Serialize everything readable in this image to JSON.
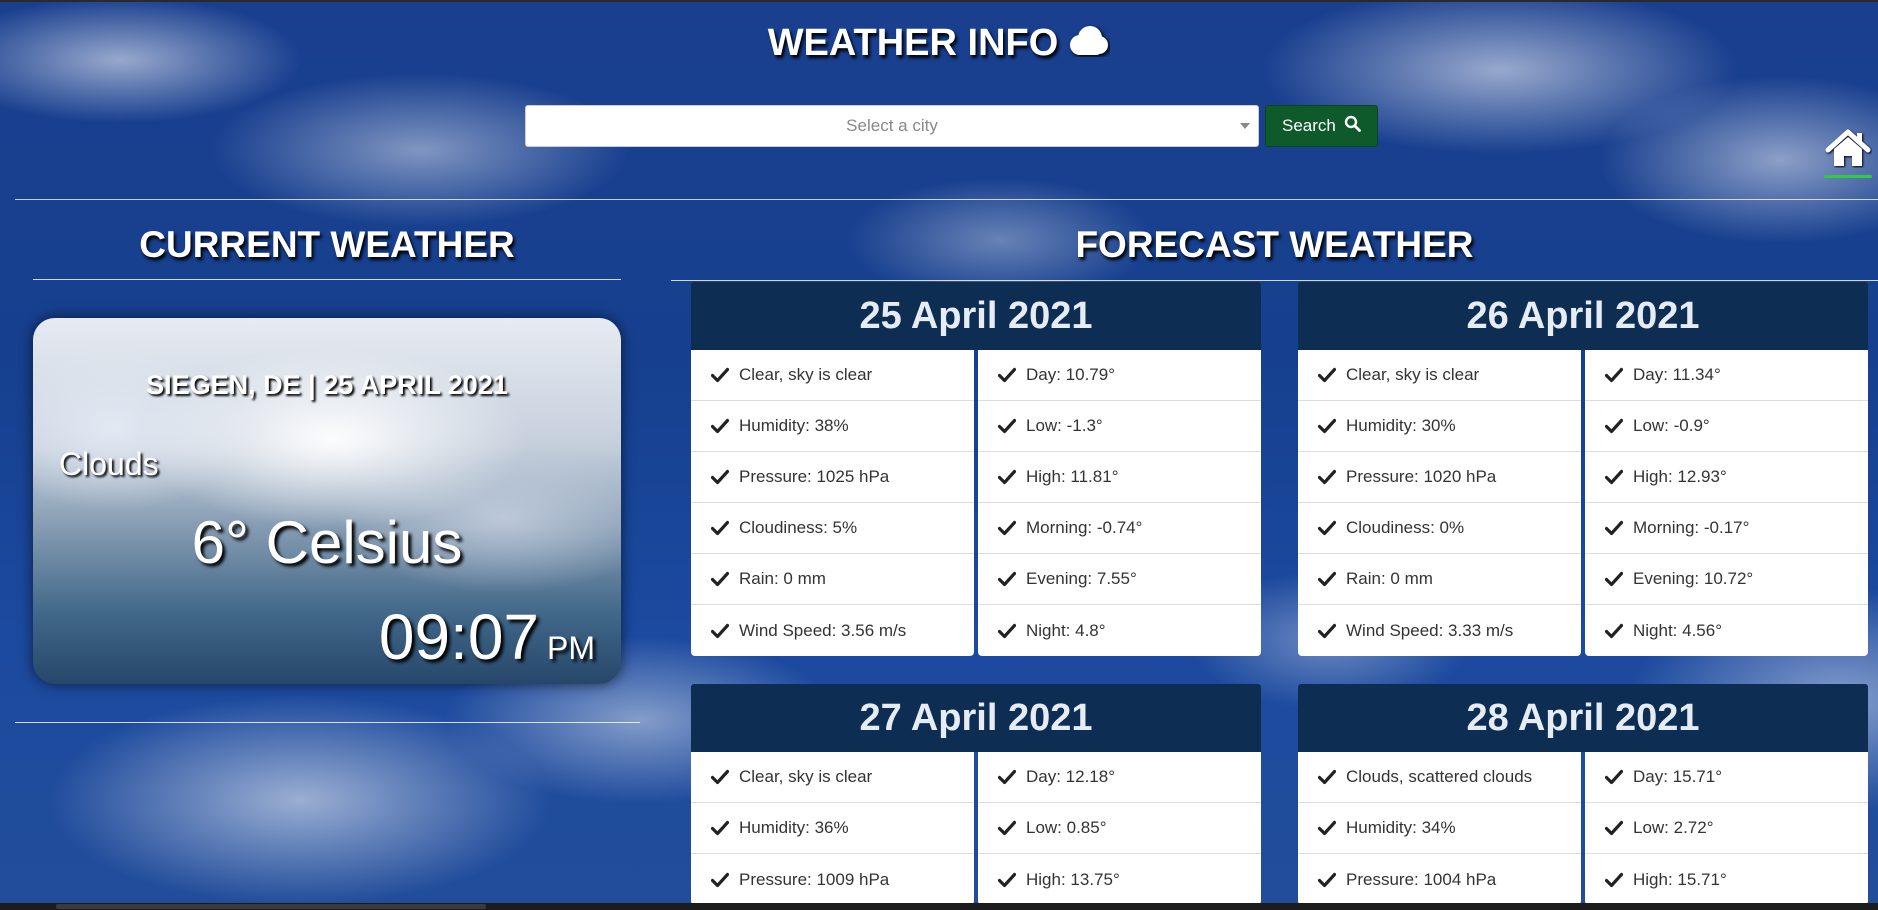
{
  "header": {
    "title": "WEATHER INFO"
  },
  "search": {
    "placeholder": "Select a city",
    "button_label": "Search"
  },
  "current": {
    "section_title": "CURRENT WEATHER",
    "location_date": "SIEGEN, DE | 25 APRIL 2021",
    "description": "Clouds",
    "temperature": "6° Celsius",
    "time": "09:07",
    "ampm": "PM"
  },
  "forecast": {
    "section_title": "FORECAST WEATHER",
    "days": [
      {
        "date": "25 April 2021",
        "left": [
          "Clear, sky is clear",
          "Humidity: 38%",
          "Pressure: 1025 hPa",
          "Cloudiness: 5%",
          "Rain: 0 mm",
          "Wind Speed: 3.56 m/s"
        ],
        "right": [
          "Day: 10.79°",
          "Low: -1.3°",
          "High: 11.81°",
          "Morning: -0.74°",
          "Evening: 7.55°",
          "Night: 4.8°"
        ]
      },
      {
        "date": "26 April 2021",
        "left": [
          "Clear, sky is clear",
          "Humidity: 30%",
          "Pressure: 1020 hPa",
          "Cloudiness: 0%",
          "Rain: 0 mm",
          "Wind Speed: 3.33 m/s"
        ],
        "right": [
          "Day: 11.34°",
          "Low: -0.9°",
          "High: 12.93°",
          "Morning: -0.17°",
          "Evening: 10.72°",
          "Night: 4.56°"
        ]
      },
      {
        "date": "27 April 2021",
        "left": [
          "Clear, sky is clear",
          "Humidity: 36%",
          "Pressure: 1009 hPa"
        ],
        "right": [
          "Day: 12.18°",
          "Low: 0.85°",
          "High: 13.75°"
        ]
      },
      {
        "date": "28 April 2021",
        "left": [
          "Clouds, scattered clouds",
          "Humidity: 34%",
          "Pressure: 1004 hPa"
        ],
        "right": [
          "Day: 15.71°",
          "Low: 2.72°",
          "High: 15.71°"
        ]
      }
    ]
  },
  "icons": {
    "title": "cloud-icon",
    "search": "search-icon",
    "home": "home-icon",
    "row": "check-icon",
    "select": "chevron-down-icon"
  },
  "colors": {
    "forecast_header": "#0e2d52",
    "search_button": "#0f5a2a",
    "home_underline": "#2ecc40"
  }
}
